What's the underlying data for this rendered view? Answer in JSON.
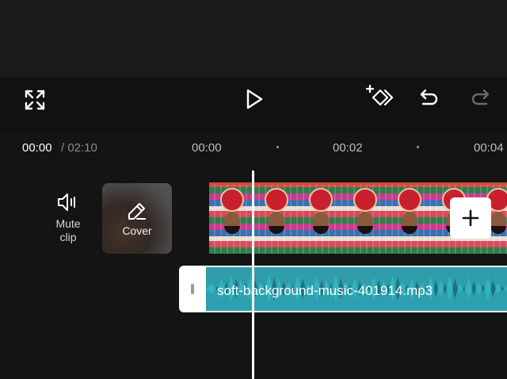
{
  "toolbar": {
    "fullscreen_icon": "expand-corners-icon",
    "play_icon": "play-icon",
    "keyframe_icon": "add-keyframe-icon",
    "undo_icon": "undo-icon",
    "redo_icon": "redo-icon"
  },
  "timeline": {
    "current_time": "00:00",
    "total_time": "/ 02:10",
    "ticks": [
      "00:00",
      "00:02",
      "00:04"
    ]
  },
  "side_tools": {
    "mute_label": "Mute\nclip",
    "cover_label": "Cover"
  },
  "audio": {
    "file_name": "soft-background-music-401914.mp3"
  },
  "colors": {
    "background": "#141414",
    "toolbar": "#111111",
    "audio_track": "#1f6f7a",
    "audio_wave": "#3cc2d2",
    "clip_top_border": "#c9502a"
  }
}
